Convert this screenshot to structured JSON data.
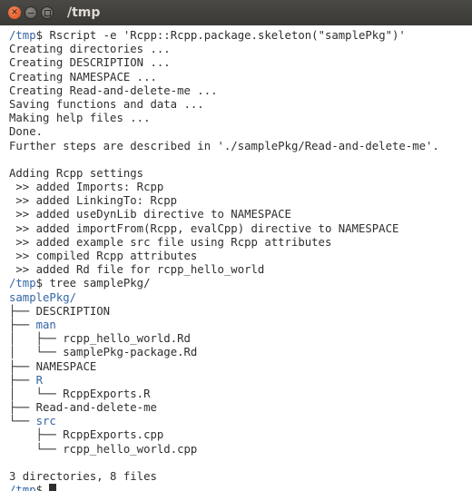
{
  "window": {
    "title": "/tmp"
  },
  "terminal": {
    "prompt_path": "/tmp",
    "prompt_suffix": "$ ",
    "lines": [
      {
        "type": "prompt",
        "cmd": "Rscript -e 'Rcpp::Rcpp.package.skeleton(\"samplePkg\")'"
      },
      {
        "type": "out",
        "text": "Creating directories ..."
      },
      {
        "type": "out",
        "text": "Creating DESCRIPTION ..."
      },
      {
        "type": "out",
        "text": "Creating NAMESPACE ..."
      },
      {
        "type": "out",
        "text": "Creating Read-and-delete-me ..."
      },
      {
        "type": "out",
        "text": "Saving functions and data ..."
      },
      {
        "type": "out",
        "text": "Making help files ..."
      },
      {
        "type": "out",
        "text": "Done."
      },
      {
        "type": "out",
        "text": "Further steps are described in './samplePkg/Read-and-delete-me'."
      },
      {
        "type": "out",
        "text": ""
      },
      {
        "type": "out",
        "text": "Adding Rcpp settings"
      },
      {
        "type": "out",
        "text": " >> added Imports: Rcpp"
      },
      {
        "type": "out",
        "text": " >> added LinkingTo: Rcpp"
      },
      {
        "type": "out",
        "text": " >> added useDynLib directive to NAMESPACE"
      },
      {
        "type": "out",
        "text": " >> added importFrom(Rcpp, evalCpp) directive to NAMESPACE"
      },
      {
        "type": "out",
        "text": " >> added example src file using Rcpp attributes"
      },
      {
        "type": "out",
        "text": " >> compiled Rcpp attributes"
      },
      {
        "type": "out",
        "text": " >> added Rd file for rcpp_hello_world"
      },
      {
        "type": "prompt",
        "cmd": "tree samplePkg/"
      },
      {
        "type": "tree",
        "prefix": "",
        "name": "samplePkg/",
        "dir": true
      },
      {
        "type": "tree",
        "prefix": "├── ",
        "name": "DESCRIPTION",
        "dir": false
      },
      {
        "type": "tree",
        "prefix": "├── ",
        "name": "man",
        "dir": true
      },
      {
        "type": "tree",
        "prefix": "│   ├── ",
        "name": "rcpp_hello_world.Rd",
        "dir": false
      },
      {
        "type": "tree",
        "prefix": "│   └── ",
        "name": "samplePkg-package.Rd",
        "dir": false
      },
      {
        "type": "tree",
        "prefix": "├── ",
        "name": "NAMESPACE",
        "dir": false
      },
      {
        "type": "tree",
        "prefix": "├── ",
        "name": "R",
        "dir": true
      },
      {
        "type": "tree",
        "prefix": "│   └── ",
        "name": "RcppExports.R",
        "dir": false
      },
      {
        "type": "tree",
        "prefix": "├── ",
        "name": "Read-and-delete-me",
        "dir": false
      },
      {
        "type": "tree",
        "prefix": "└── ",
        "name": "src",
        "dir": true
      },
      {
        "type": "tree",
        "prefix": "    ├── ",
        "name": "RcppExports.cpp",
        "dir": false
      },
      {
        "type": "tree",
        "prefix": "    └── ",
        "name": "rcpp_hello_world.cpp",
        "dir": false
      },
      {
        "type": "out",
        "text": ""
      },
      {
        "type": "out",
        "text": "3 directories, 8 files"
      },
      {
        "type": "prompt",
        "cmd": "",
        "cursor": true
      }
    ]
  }
}
